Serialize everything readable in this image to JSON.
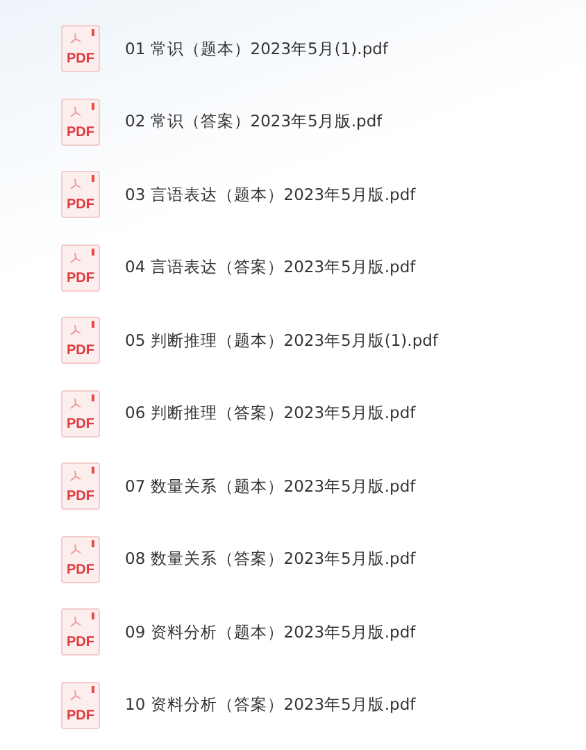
{
  "files": [
    {
      "name": "01 常识（题本）2023年5月(1).pdf",
      "icon_label": "PDF"
    },
    {
      "name": "02 常识（答案）2023年5月版.pdf",
      "icon_label": "PDF"
    },
    {
      "name": "03 言语表达（题本）2023年5月版.pdf",
      "icon_label": "PDF"
    },
    {
      "name": "04 言语表达（答案）2023年5月版.pdf",
      "icon_label": "PDF"
    },
    {
      "name": "05 判断推理（题本）2023年5月版(1).pdf",
      "icon_label": "PDF"
    },
    {
      "name": "06 判断推理（答案）2023年5月版.pdf",
      "icon_label": "PDF"
    },
    {
      "name": "07 数量关系（题本）2023年5月版.pdf",
      "icon_label": "PDF"
    },
    {
      "name": "08 数量关系（答案）2023年5月版.pdf",
      "icon_label": "PDF"
    },
    {
      "name": "09 资料分析（题本）2023年5月版.pdf",
      "icon_label": "PDF"
    },
    {
      "name": "10 资料分析（答案）2023年5月版.pdf",
      "icon_label": "PDF"
    }
  ]
}
